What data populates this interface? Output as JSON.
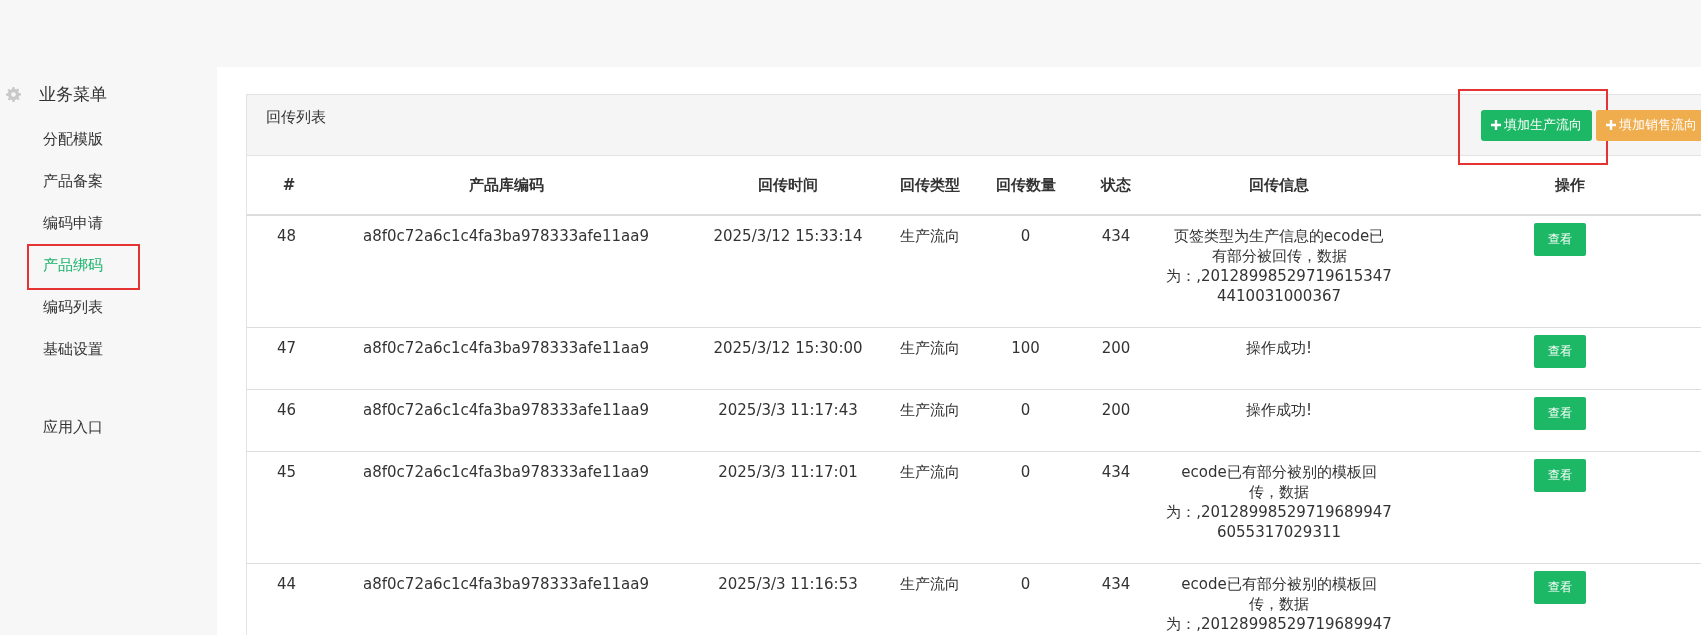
{
  "sidebar": {
    "title": "业务菜单",
    "items": [
      {
        "label": "分配模版",
        "selected": false,
        "highlighted": false
      },
      {
        "label": "产品备案",
        "selected": false,
        "highlighted": false
      },
      {
        "label": "编码申请",
        "selected": false,
        "highlighted": false
      },
      {
        "label": "产品绑码",
        "selected": true,
        "highlighted": true
      },
      {
        "label": "编码列表",
        "selected": false,
        "highlighted": false
      },
      {
        "label": "基础设置",
        "selected": false,
        "highlighted": false
      }
    ],
    "footer_item": {
      "label": "应用入口",
      "selected": false
    }
  },
  "panel": {
    "title": "回传列表",
    "buttons": [
      {
        "label": "填加生产流向",
        "kind": "success",
        "highlighted": true
      },
      {
        "label": "填加销售流向",
        "kind": "warning",
        "highlighted": false
      }
    ]
  },
  "table": {
    "columns": [
      "#",
      "产品库编码",
      "回传时间",
      "回传类型",
      "回传数量",
      "状态",
      "回传信息",
      "操作"
    ],
    "rows": [
      {
        "id": "48",
        "code": "a8f0c72a6c1c4fa3ba978333afe11aa9",
        "time": "2025/3/12 15:33:14",
        "type": "生产流向",
        "count": "0",
        "status": "434",
        "info": [
          "页签类型为生产信息的ecode已",
          "有部分被回传，数据",
          "为：,20128998529719615347",
          "4410031000367"
        ],
        "action": "查看"
      },
      {
        "id": "47",
        "code": "a8f0c72a6c1c4fa3ba978333afe11aa9",
        "time": "2025/3/12 15:30:00",
        "type": "生产流向",
        "count": "100",
        "status": "200",
        "info": [
          "操作成功!"
        ],
        "action": "查看"
      },
      {
        "id": "46",
        "code": "a8f0c72a6c1c4fa3ba978333afe11aa9",
        "time": "2025/3/3 11:17:43",
        "type": "生产流向",
        "count": "0",
        "status": "200",
        "info": [
          "操作成功!"
        ],
        "action": "查看"
      },
      {
        "id": "45",
        "code": "a8f0c72a6c1c4fa3ba978333afe11aa9",
        "time": "2025/3/3 11:17:01",
        "type": "生产流向",
        "count": "0",
        "status": "434",
        "info": [
          "ecode已有部分被别的模板回",
          "传，数据",
          "为：,20128998529719689947",
          "6055317029311"
        ],
        "action": "查看"
      },
      {
        "id": "44",
        "code": "a8f0c72a6c1c4fa3ba978333afe11aa9",
        "time": "2025/3/3 11:16:53",
        "type": "生产流向",
        "count": "0",
        "status": "434",
        "info": [
          "ecode已有部分被别的模板回",
          "传，数据",
          "为：,20128998529719689947"
        ],
        "action": "查看"
      }
    ]
  }
}
